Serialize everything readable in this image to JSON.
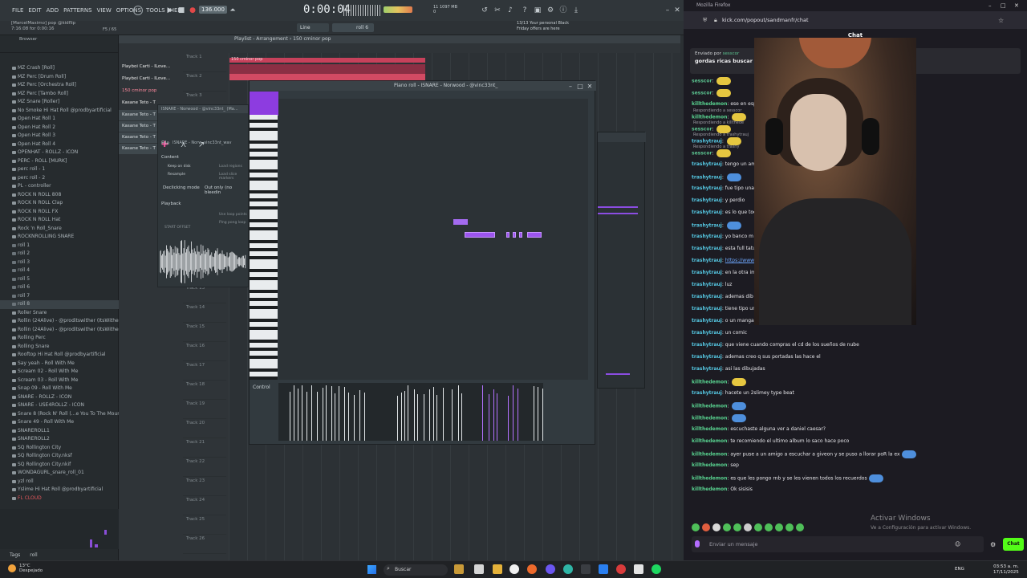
{
  "fl": {
    "menu": [
      "FILE",
      "EDIT",
      "ADD",
      "PATTERNS",
      "VIEW",
      "OPTIONS",
      "TOOLS",
      "HELP"
    ],
    "hint_user": "[MarcelMaximo] pop @kidflip",
    "hint_time": "7:16:08 for 0:00:16",
    "hint_count": "F5 / 65",
    "tempo": "136.000",
    "time": "0:00:04",
    "cpu_a": "11",
    "cpu_b": "1097 MB",
    "cpu_c": "0",
    "line_mode": "Line",
    "pattern": "roll 6",
    "news_1": "13/13  Your personal Black",
    "news_2": "Friday offers are here",
    "browser": {
      "header": "Browser",
      "items": [
        {
          "label": "MZ Crash [Roll]",
          "type": "file"
        },
        {
          "label": "MZ Perc [Drum Roll]",
          "type": "file"
        },
        {
          "label": "MZ Perc [Orchestra Roll]",
          "type": "file"
        },
        {
          "label": "MZ Perc [Tambo Roll]",
          "type": "file"
        },
        {
          "label": "MZ Snare [Roller]",
          "type": "file"
        },
        {
          "label": "No Smoke Hi Hat Roll @prodbyartificial",
          "type": "file"
        },
        {
          "label": "Open Hat Roll 1",
          "type": "file"
        },
        {
          "label": "Open Hat Roll 2",
          "type": "file"
        },
        {
          "label": "Open Hat Roll 3",
          "type": "file"
        },
        {
          "label": "Open Hat Roll 4",
          "type": "file"
        },
        {
          "label": "OPENHAT - ROLLZ - ICON",
          "type": "file"
        },
        {
          "label": "PERC - ROLL [MURK]",
          "type": "file"
        },
        {
          "label": "perc roll - 1",
          "type": "file"
        },
        {
          "label": "perc roll - 2",
          "type": "file"
        },
        {
          "label": "PL - controller",
          "type": "file"
        },
        {
          "label": "ROCK N ROLL 808",
          "type": "file"
        },
        {
          "label": "ROCK N ROLL Clap",
          "type": "file"
        },
        {
          "label": "ROCK N ROLL FX",
          "type": "file"
        },
        {
          "label": "ROCK N ROLL Hat",
          "type": "file"
        },
        {
          "label": "Rock 'n Roll_Snare",
          "type": "file"
        },
        {
          "label": "ROCKNROLLING SNARE",
          "type": "file"
        },
        {
          "label": "roll 1",
          "type": "folder"
        },
        {
          "label": "roll 2",
          "type": "folder"
        },
        {
          "label": "roll 3",
          "type": "folder"
        },
        {
          "label": "roll 4",
          "type": "folder"
        },
        {
          "label": "roll 5",
          "type": "folder"
        },
        {
          "label": "roll 6",
          "type": "folder"
        },
        {
          "label": "roll 7",
          "type": "folder"
        },
        {
          "label": "roll 8",
          "type": "folder",
          "selected": true
        },
        {
          "label": "Roller Snare",
          "type": "file"
        },
        {
          "label": "Rollin (24Alive) - @proditswither (ItsWither)",
          "type": "file"
        },
        {
          "label": "Rollin (24Alive) - @proditswither (ItsWither)",
          "type": "file"
        },
        {
          "label": "Rolling Perc",
          "type": "file"
        },
        {
          "label": "Rolling Snare",
          "type": "file"
        },
        {
          "label": "Rooftop Hi Hat Roll @prodbyartificial",
          "type": "file"
        },
        {
          "label": "Say yeah - Roll With Me",
          "type": "file"
        },
        {
          "label": "Scream 02 - Roll With Me",
          "type": "file"
        },
        {
          "label": "Scream 03 - Roll With Me",
          "type": "file"
        },
        {
          "label": "Snap 09 - Roll With Me",
          "type": "file"
        },
        {
          "label": "SNARE - ROLLZ - ICON",
          "type": "file"
        },
        {
          "label": "SNARE - USE4ROLLZ - ICON",
          "type": "file"
        },
        {
          "label": "Snare 8 (Rock N' Roll (...e You To The Mountain))",
          "type": "file"
        },
        {
          "label": "Snare 49 - Roll With Me",
          "type": "file"
        },
        {
          "label": "SNAREROLL1",
          "type": "file"
        },
        {
          "label": "SNAREROLL2",
          "type": "file"
        },
        {
          "label": "SQ Rollington City",
          "type": "file"
        },
        {
          "label": "SQ Rollington City.nksf",
          "type": "file"
        },
        {
          "label": "SQ Rollington City.nkif",
          "type": "file"
        },
        {
          "label": "WONDAGURL_snare_roll_01",
          "type": "file"
        },
        {
          "label": "yzl roll",
          "type": "file"
        },
        {
          "label": "Yslime Hi Hat Roll @prodbyartificial",
          "type": "file"
        },
        {
          "label": "FL CLOUD",
          "type": "cloud"
        }
      ],
      "tags_label": "Tags",
      "tags_value": "roll"
    },
    "playlist": {
      "title": "Playlist - Arrangement › 150 cminor pop",
      "patterns": [
        {
          "label": "Playboi Carti - ILove...",
          "style": "normal"
        },
        {
          "label": "Playboi Carti - ILove...",
          "style": "normal"
        },
        {
          "label": "150 cminor pop",
          "style": "hi"
        },
        {
          "label": "Kasane Teto - T",
          "style": "normal"
        },
        {
          "label": "Kasane Teto - T",
          "style": "gr"
        },
        {
          "label": "Kasane Teto - T",
          "style": "gr"
        },
        {
          "label": "Kasane Teto - T",
          "style": "gr"
        },
        {
          "label": "Kasane Teto - T",
          "style": "gr"
        }
      ],
      "tracks": [
        "Track 1",
        "Track 2",
        "Track 3",
        "Track 4",
        "Track 5",
        "Track 6",
        "Track 7",
        "Track 8",
        "Track 9",
        "Track 10",
        "Track 11",
        "Track 12",
        "Track 13",
        "Track 14",
        "Track 15",
        "Track 16",
        "Track 17",
        "Track 18",
        "Track 19",
        "Track 20",
        "Track 21",
        "Track 22",
        "Track 23",
        "Track 24",
        "Track 25",
        "Track 26"
      ],
      "clip_label": "150 cminor pop"
    },
    "channel": {
      "title": "ISNARE - Norwood - @vinc33nt_ (Ma...",
      "file_label": "File",
      "file_name": "ISNARE - Norw..vinc33nt_wav",
      "content": "Content",
      "keep_on_disk": "Keep on disk",
      "resample": "Resample",
      "load_regions": "Load regions",
      "load_slice": "Load slice markers",
      "declicking": "Declicking mode",
      "declicking_value": "Out only (no bleedin",
      "playback": "Playback",
      "use_loop": "Use loop points",
      "ping_pong": "Ping pong loop",
      "start_offset": "START OFFSET"
    },
    "pianoroll": {
      "title": "Piano roll - ISNARE - Norwood - @vinc33nt_",
      "control": "Control",
      "note_label": "G#5"
    }
  },
  "firefox": {
    "title": "Mozilla Firefox",
    "url": "kick.com/popout/sandmanfr/chat",
    "chat_header": "Chat",
    "pinned_by": "Enviado por",
    "pinned_user": "sesscor",
    "pinned_text": "gordas ricas buscar",
    "messages": [
      {
        "user": "sesscor",
        "cls": "s",
        "text": "",
        "emote": true
      },
      {
        "user": "sesscor",
        "cls": "s",
        "text": "",
        "emote": true
      },
      {
        "user": "killthedemon",
        "cls": "k",
        "text": "ese en esp",
        "emote": false
      },
      {
        "user": "killthedemon",
        "cls": "k",
        "text": "",
        "emote": true,
        "reply": "Respondiendo a sesscor"
      },
      {
        "user": "sesscor",
        "cls": "s",
        "text": "",
        "emote": true,
        "reply": "Respondiendo a killthede"
      },
      {
        "user": "trashytrauj",
        "cls": "t",
        "text": "",
        "emote": true,
        "reply": "Respondiendo a trashytrauj"
      },
      {
        "user": "sesscor",
        "cls": "s",
        "text": "",
        "emote": true,
        "reply": "Respondiendo a trashy"
      },
      {
        "user": "trashytrauj",
        "cls": "t",
        "text": "tengo un am",
        "emote": false
      },
      {
        "user": "trashytrauj",
        "cls": "t",
        "text": "",
        "emote": true,
        "blue": true
      },
      {
        "user": "trashytrauj",
        "cls": "t",
        "text": "fue tipo una",
        "emote": false
      },
      {
        "user": "trashytrauj",
        "cls": "t",
        "text": "y perdio",
        "emote": false
      },
      {
        "user": "trashytrauj",
        "cls": "t",
        "text": "es lo que toc",
        "emote": false
      },
      {
        "user": "trashytrauj",
        "cls": "t",
        "text": "",
        "emote": true,
        "blue": true
      },
      {
        "user": "trashytrauj",
        "cls": "t",
        "text": "yo banco m",
        "emote": false
      },
      {
        "user": "trashytrauj",
        "cls": "t",
        "text": "esta full tatu",
        "emote": false
      },
      {
        "user": "trashytrauj",
        "cls": "t",
        "text": "https://www",
        "emote": false,
        "link": true
      },
      {
        "user": "trashytrauj",
        "cls": "t",
        "text": "en la otra im",
        "emote": false
      },
      {
        "user": "trashytrauj",
        "cls": "t",
        "text": "luz",
        "emote": false
      },
      {
        "user": "trashytrauj",
        "cls": "t",
        "text": "ademas dib",
        "emote": false
      },
      {
        "user": "trashytrauj",
        "cls": "t",
        "text": "tiene tipo un libro",
        "emote": false
      },
      {
        "user": "trashytrauj",
        "cls": "t",
        "text": "o un manga no me acuerdo",
        "emote": false
      },
      {
        "user": "trashytrauj",
        "cls": "t",
        "text": "un comic",
        "emote": false
      },
      {
        "user": "trashytrauj",
        "cls": "t",
        "text": "que viene cuando compras el cd de los sueños de nube",
        "emote": false
      },
      {
        "user": "trashytrauj",
        "cls": "t",
        "text": "ademas creo q sus portadas las hace el",
        "emote": false
      },
      {
        "user": "trashytrauj",
        "cls": "t",
        "text": "asi las dibujadas",
        "emote": false
      },
      {
        "user": "killthedemon",
        "cls": "k",
        "text": "",
        "emote": true
      },
      {
        "user": "trashytrauj",
        "cls": "t",
        "text": "hacete un 2slimey type beat",
        "emote": false
      },
      {
        "user": "killthedemon",
        "cls": "k",
        "text": "",
        "emote": true,
        "blue": true
      },
      {
        "user": "killthedemon",
        "cls": "k",
        "text": "",
        "emote": true,
        "blue": true
      },
      {
        "user": "killthedemon",
        "cls": "k",
        "text": "escuchaste alguna ver a daniel caesar?",
        "emote": false
      },
      {
        "user": "killthedemon",
        "cls": "k",
        "text": "te recomiendo el ultimo album lo saco hace poco",
        "emote": false
      },
      {
        "user": "killthedemon",
        "cls": "k",
        "text": "ayer puse a un amigo a escuchar a giveon y se puso a llorar poR la ex",
        "emote": true,
        "blue": true
      },
      {
        "user": "killthedemon",
        "cls": "k",
        "text": "sep",
        "emote": false
      },
      {
        "user": "killthedemon",
        "cls": "k",
        "text": "es que les pongo rnb y se les vienen todos los recuerdos",
        "emote": true,
        "blue": true
      },
      {
        "user": "killthedemon",
        "cls": "k",
        "text": "Ok sisisis",
        "emote": false
      }
    ],
    "input_placeholder": "Enviar un mensaje",
    "send": "Chat",
    "activate_title": "Activar Windows",
    "activate_sub": "Ve a Configuración para activar Windows."
  },
  "taskbar": {
    "temp": "13°C",
    "weather": "Despejado",
    "search": "Buscar",
    "lang": "ENG",
    "time": "03:53 a. m.",
    "date": "17/11/2025"
  }
}
